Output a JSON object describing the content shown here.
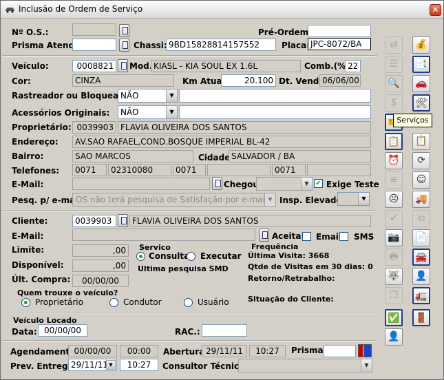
{
  "window": {
    "title": "Inclusão de Ordem de Serviço",
    "close": "✕"
  },
  "labels": {
    "os": "Nº O.S.:",
    "prisma_atend": "Prisma Atend.:",
    "pre_ordem": "Pré-Ordem:",
    "chassi": "Chassi:",
    "placa": "Placa:",
    "veiculo": "Veículo:",
    "mod": "Mod.:",
    "comb": "Comb.(%):",
    "cor": "Cor:",
    "km_atual": "Km Atual:",
    "dt_venda": "Dt. Venda:",
    "rastreador": "Rastreador ou Bloqueador:",
    "acessorios": "Acessórios Originais:",
    "proprietario": "Proprietário:",
    "endereco": "Endereço:",
    "bairro": "Bairro:",
    "cidade": "Cidade:",
    "telefones": "Telefones:",
    "email": "E-Mail:",
    "chegou": "Chegou:",
    "exige_teste": "Exige Teste",
    "pesq": "Pesq. p/ e-mail:",
    "insp": "Insp. Elevador:",
    "cliente": "Cliente:",
    "email2": "E-Mail:",
    "aceita": "Aceita:",
    "email_opt": "Email",
    "sms": "SMS",
    "limite": "Limite:",
    "disponivel": "Disponível:",
    "ult_compra": "Últ. Compra:",
    "servico": "Servico",
    "consultar": "Consultar",
    "executar": "Executar",
    "ultima_pesquisa": "Ultima pesquisa SMD",
    "frequencia": "Frequência",
    "ultima_visita": "Última Visita: 3668",
    "qtde": "Qtde de Visitas em 30 dias: 0",
    "retorno": "Retorno/Retrabalho:",
    "quem_trouxe": "Quem trouxe o veículo?",
    "opt_prop": "Proprietário",
    "opt_cond": "Condutor",
    "opt_usu": "Usuário",
    "situacao": "Situação do Cliente:",
    "veiculo_locado": "Veículo Locado",
    "data": "Data:",
    "rac": "RAC.:",
    "agendamento": "Agendamento:",
    "abertura": "Abertura:",
    "prisma": "Prisma:",
    "prev_entrega": "Prev. Entrega:",
    "consultor": "Consultor Técnico:"
  },
  "values": {
    "os": "",
    "prisma_atend": "",
    "pre_ordem": "",
    "chassi": "9BD15828814157552",
    "placa": "JPC-8072/BA",
    "veiculo": "0008821",
    "modelo": "KIASL - KIA SOUL EX 1.6L",
    "comb": "22",
    "cor": "CINZA",
    "km_atual": "20.100",
    "dt_venda": "06/06/00",
    "rastreador": "NÃO",
    "acessorios": "NÃO",
    "prop_code": "0039903",
    "prop_name": "FLAVIA OLIVEIRA DOS SANTOS",
    "endereco": "AV.SAO RAFAEL,COND.BOSQUE IMPERIAL BL-42",
    "bairro": "SAO MARCOS",
    "cidade": "SALVADOR / BA",
    "tel1": "0071",
    "tel2": "02310080",
    "tel3": "0071",
    "tel4": "",
    "tel5": "0071",
    "tel6": "",
    "email": "",
    "chegou": "",
    "pesq": "OS não terá pesquisa de Satisfação por e-mail",
    "insp": "",
    "cliente_code": "0039903",
    "cliente_name": "FLAVIA OLIVEIRA DOS SANTOS",
    "email2": "",
    "limite": ",00",
    "disponivel": ",00",
    "ult_compra": "00/00/00",
    "data_locado": "00/00/00",
    "rac": "",
    "agend_data": "00/00/00",
    "agend_hora": "00:00",
    "abertura_data": "29/11/11",
    "abertura_hora": "10:27",
    "prisma": "",
    "prev_data": "29/11/11",
    "prev_hora": "10:27",
    "consultor": ""
  },
  "toolbar": {
    "tooltip": "Serviços"
  }
}
